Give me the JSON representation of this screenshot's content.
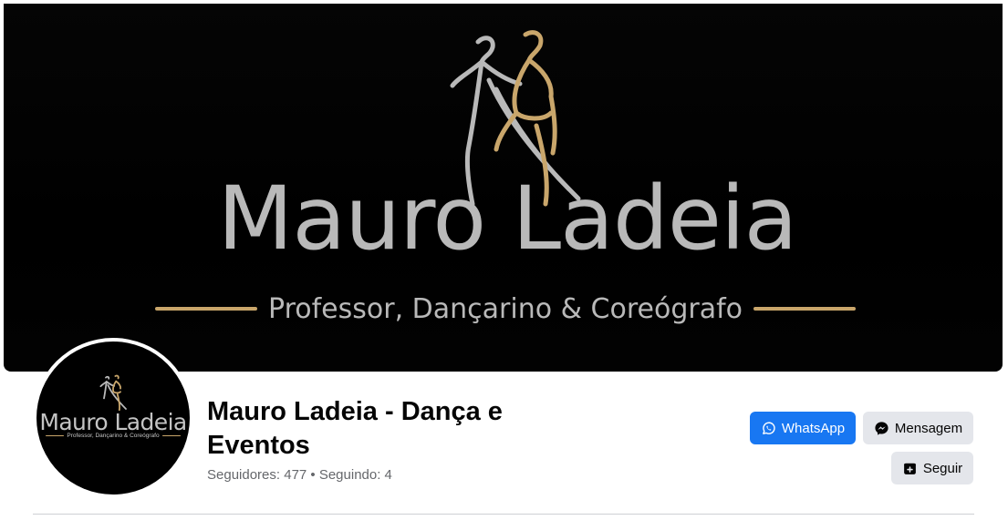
{
  "cover": {
    "title": "Mauro Ladeia",
    "subtitle": "Professor, Dançarino & Coreógrafo",
    "colors": {
      "background": "#000000",
      "text": "#b9b9b9",
      "gold": "#c9a66b"
    }
  },
  "avatar": {
    "title": "Mauro Ladeia",
    "subtitle": "Professor, Dançarino & Coreógrafo"
  },
  "profile": {
    "name": "Mauro Ladeia - Dança e Eventos",
    "stats": "Seguidores: 477 • Seguindo: 4"
  },
  "actions": {
    "whatsapp": {
      "label": "WhatsApp",
      "icon": "whatsapp-icon",
      "color": "#1877f2"
    },
    "message": {
      "label": "Mensagem",
      "icon": "messenger-icon",
      "color": "#e4e6eb"
    },
    "follow": {
      "label": "Seguir",
      "icon": "follow-icon",
      "color": "#e4e6eb"
    }
  }
}
